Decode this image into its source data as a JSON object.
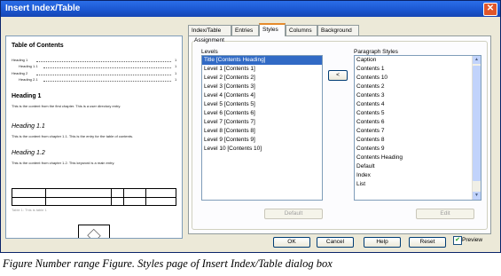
{
  "window": {
    "title": "Insert Index/Table",
    "close_glyph": "✕"
  },
  "preview": {
    "toc_title": "Table of Contents",
    "toc_entries": [
      {
        "text": "Heading 1",
        "page": "1"
      },
      {
        "text": "Heading 1.1",
        "page": "1"
      },
      {
        "text": "Heading 2",
        "page": "1"
      },
      {
        "text": "Heading 2.1",
        "page": "1"
      }
    ],
    "sections": [
      {
        "heading": "Heading 1",
        "body": "This is the content from the first chapter. This is a user directory entry."
      },
      {
        "heading": "Heading 1.1",
        "body": "This is the content from chapter 1.1. This is the entry for the table of contents."
      },
      {
        "heading": "Heading 1.2",
        "body": "This is the content from chapter 1.2. This keyword is a main entry."
      }
    ],
    "table_caption": "Table 1: This is table 1"
  },
  "tabs": [
    {
      "label": "Index/Table",
      "active": false
    },
    {
      "label": "Entries",
      "active": false
    },
    {
      "label": "Styles",
      "active": true
    },
    {
      "label": "Columns",
      "active": false
    },
    {
      "label": "Background",
      "active": false
    }
  ],
  "assignment": {
    "group_label": "Assignment",
    "levels_label": "Levels",
    "levels": [
      "Title [Contents Heading]",
      "Level 1 [Contents 1]",
      "Level 2 [Contents 2]",
      "Level 3 [Contents 3]",
      "Level 4 [Contents 4]",
      "Level 5 [Contents 5]",
      "Level 6 [Contents 6]",
      "Level 7 [Contents 7]",
      "Level 8 [Contents 8]",
      "Level 9 [Contents 9]",
      "Level 10 [Contents 10]"
    ],
    "selected_level_index": 0,
    "assign_button": "<",
    "paragraph_styles_label": "Paragraph Styles",
    "paragraph_styles": [
      "Caption",
      "Contents 1",
      "Contents 10",
      "Contents 2",
      "Contents 3",
      "Contents 4",
      "Contents 5",
      "Contents 6",
      "Contents 7",
      "Contents 8",
      "Contents 9",
      "Contents Heading",
      "Default",
      "Index",
      "List"
    ],
    "default_button": "Default",
    "edit_button": "Edit"
  },
  "buttons": {
    "ok": "OK",
    "cancel": "Cancel",
    "help": "Help",
    "reset": "Reset"
  },
  "preview_checkbox": {
    "label": "Preview",
    "checked": true,
    "glyph": "✔"
  },
  "caption": "Figure Number range Figure. Styles page of Insert Index/Table dialog box"
}
